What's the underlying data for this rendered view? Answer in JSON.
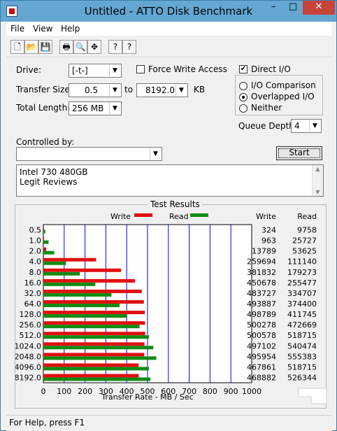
{
  "window": {
    "title": "Untitled - ATTO Disk Benchmark",
    "minimize": "–",
    "maximize": "□",
    "close": "✕"
  },
  "menu": [
    {
      "label": "File"
    },
    {
      "label": "View"
    },
    {
      "label": "Help"
    }
  ],
  "toolbar": [
    {
      "name": "new-document-icon",
      "glyph": "🗋"
    },
    {
      "name": "open-folder-icon",
      "glyph": "📂"
    },
    {
      "name": "save-icon",
      "glyph": "💾"
    },
    {
      "name": "print-icon",
      "glyph": "🖶"
    },
    {
      "name": "print-preview-icon",
      "glyph": "🔍"
    },
    {
      "name": "move-icon",
      "glyph": "✥"
    },
    {
      "name": "help-icon",
      "glyph": "?"
    },
    {
      "name": "context-help-icon",
      "glyph": "?"
    }
  ],
  "form": {
    "drive_label": "Drive:",
    "drive_value": "[-t-]",
    "force_write_label": "Force Write Access",
    "direct_io_label": "Direct I/O",
    "direct_io_checked": "✔",
    "transfer_size_label": "Transfer Size:",
    "transfer_from": "0.5",
    "to_label": "to",
    "transfer_to": "8192.0",
    "kb_label": "KB",
    "total_length_label": "Total Length:",
    "total_length_value": "256 MB",
    "io_comparison_label": "I/O Comparison",
    "overlapped_io_label": "Overlapped I/O",
    "neither_label": "Neither",
    "queue_depth_label": "Queue Depth:",
    "queue_depth_value": "4",
    "controlled_by_label": "Controlled by:",
    "controlled_by_value": "",
    "start_button": "Start",
    "description_line1": "Intel 730 480GB",
    "description_line2": "Legit Reviews"
  },
  "results": {
    "title": "Test Results",
    "legend_write": "Write",
    "legend_read": "Read",
    "col_write": "Write",
    "col_read": "Read"
  },
  "status": {
    "text": "For Help, press F1"
  },
  "colors": {
    "write": "#e01010",
    "read": "#138b13",
    "grid": "#0000ff"
  },
  "chart_data": {
    "type": "bar",
    "orientation": "horizontal",
    "xlabel": "Transfer Rate - MB / Sec",
    "xlim": [
      0,
      1000
    ],
    "xticks": [
      0,
      100,
      200,
      300,
      400,
      500,
      600,
      700,
      800,
      900,
      1000
    ],
    "categories": [
      "0.5",
      "1.0",
      "2.0",
      "4.0",
      "8.0",
      "16.0",
      "32.0",
      "64.0",
      "128.0",
      "256.0",
      "512.0",
      "1024.0",
      "2048.0",
      "4096.0",
      "8192.0"
    ],
    "series": [
      {
        "name": "Write",
        "values": [
          324,
          963,
          13789,
          259694,
          381832,
          450678,
          483727,
          493887,
          498789,
          500278,
          500578,
          497102,
          495954,
          467861,
          468882
        ]
      },
      {
        "name": "Read",
        "values": [
          9758,
          25727,
          53625,
          111140,
          179273,
          255477,
          334707,
          374400,
          411745,
          472669,
          518715,
          540474,
          555383,
          518715,
          526344
        ]
      }
    ]
  }
}
